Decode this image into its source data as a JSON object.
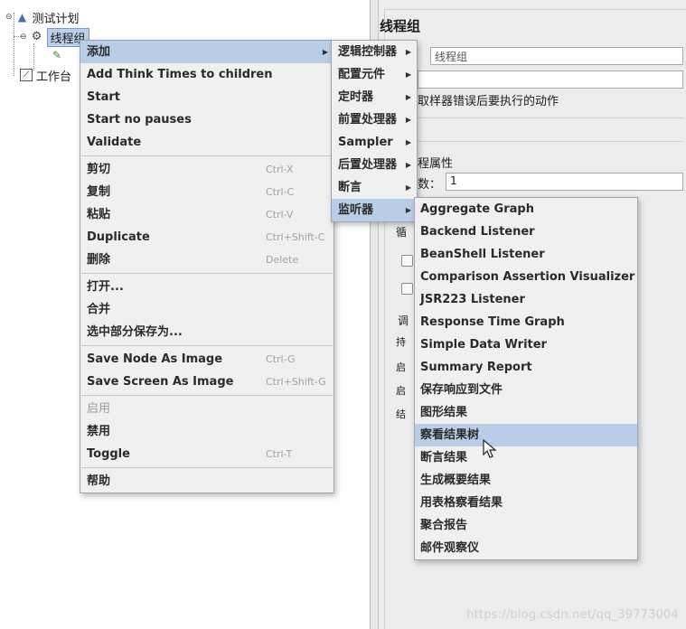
{
  "tree": {
    "plan_label": "测试计划",
    "thread_group_label": "线程组",
    "workbench_label": "工作台"
  },
  "right_pane": {
    "title": "线程组",
    "name_value": "线程组",
    "frag_error_action": "取样器错误后要执行的动作",
    "frag_props": "程属性",
    "frag_threads_prefix": "数：",
    "threads_value": "1",
    "frag_loop": "循",
    "frag_sched": "调",
    "frag_duration": "持",
    "frag_start": "启",
    "frag_start2": "启",
    "frag_end": "结"
  },
  "add_menu": {
    "items": [
      {
        "label": "添加",
        "shortcut": "",
        "submenu": true,
        "selected": true,
        "disabled": false
      },
      {
        "label": "Add Think Times to children",
        "shortcut": "",
        "submenu": false,
        "selected": false,
        "disabled": false
      },
      {
        "label": "Start",
        "shortcut": "",
        "submenu": false,
        "selected": false,
        "disabled": false
      },
      {
        "label": "Start no pauses",
        "shortcut": "",
        "submenu": false,
        "selected": false,
        "disabled": false
      },
      {
        "label": "Validate",
        "shortcut": "",
        "submenu": false,
        "selected": false,
        "disabled": false
      },
      {
        "sep": true
      },
      {
        "label": "剪切",
        "shortcut": "Ctrl-X",
        "submenu": false,
        "selected": false,
        "disabled": false
      },
      {
        "label": "复制",
        "shortcut": "Ctrl-C",
        "submenu": false,
        "selected": false,
        "disabled": false
      },
      {
        "label": "粘贴",
        "shortcut": "Ctrl-V",
        "submenu": false,
        "selected": false,
        "disabled": false
      },
      {
        "label": "Duplicate",
        "shortcut": "Ctrl+Shift-C",
        "submenu": false,
        "selected": false,
        "disabled": false
      },
      {
        "label": "删除",
        "shortcut": "Delete",
        "submenu": false,
        "selected": false,
        "disabled": false
      },
      {
        "sep": true
      },
      {
        "label": "打开...",
        "shortcut": "",
        "submenu": false,
        "selected": false,
        "disabled": false
      },
      {
        "label": "合并",
        "shortcut": "",
        "submenu": false,
        "selected": false,
        "disabled": false
      },
      {
        "label": "选中部分保存为...",
        "shortcut": "",
        "submenu": false,
        "selected": false,
        "disabled": false
      },
      {
        "sep": true
      },
      {
        "label": "Save Node As Image",
        "shortcut": "Ctrl-G",
        "submenu": false,
        "selected": false,
        "disabled": false
      },
      {
        "label": "Save Screen As Image",
        "shortcut": "Ctrl+Shift-G",
        "submenu": false,
        "selected": false,
        "disabled": false
      },
      {
        "sep": true
      },
      {
        "label": "启用",
        "shortcut": "",
        "submenu": false,
        "selected": false,
        "disabled": true
      },
      {
        "label": "禁用",
        "shortcut": "",
        "submenu": false,
        "selected": false,
        "disabled": false
      },
      {
        "label": "Toggle",
        "shortcut": "Ctrl-T",
        "submenu": false,
        "selected": false,
        "disabled": false
      },
      {
        "sep": true
      },
      {
        "label": "帮助",
        "shortcut": "",
        "submenu": false,
        "selected": false,
        "disabled": false
      }
    ]
  },
  "category_menu": {
    "items": [
      {
        "label": "逻辑控制器",
        "submenu": true,
        "selected": false
      },
      {
        "label": "配置元件",
        "submenu": true,
        "selected": false
      },
      {
        "label": "定时器",
        "submenu": true,
        "selected": false
      },
      {
        "label": "前置处理器",
        "submenu": true,
        "selected": false
      },
      {
        "label": "Sampler",
        "submenu": true,
        "selected": false
      },
      {
        "label": "后置处理器",
        "submenu": true,
        "selected": false
      },
      {
        "label": "断言",
        "submenu": true,
        "selected": false
      },
      {
        "label": "监听器",
        "submenu": true,
        "selected": true
      }
    ]
  },
  "listener_menu": {
    "items": [
      {
        "label": "Aggregate Graph",
        "selected": false
      },
      {
        "label": "Backend Listener",
        "selected": false
      },
      {
        "label": "BeanShell Listener",
        "selected": false
      },
      {
        "label": "Comparison Assertion Visualizer",
        "selected": false
      },
      {
        "label": "JSR223 Listener",
        "selected": false
      },
      {
        "label": "Response Time Graph",
        "selected": false
      },
      {
        "label": "Simple Data Writer",
        "selected": false
      },
      {
        "label": "Summary Report",
        "selected": false
      },
      {
        "label": "保存响应到文件",
        "selected": false
      },
      {
        "label": "图形结果",
        "selected": false
      },
      {
        "label": "察看结果树",
        "selected": true
      },
      {
        "label": "断言结果",
        "selected": false
      },
      {
        "label": "生成概要结果",
        "selected": false
      },
      {
        "label": "用表格察看结果",
        "selected": false
      },
      {
        "label": "聚合报告",
        "selected": false
      },
      {
        "label": "邮件观察仪",
        "selected": false
      }
    ]
  },
  "watermark": "https://blog.csdn.net/qq_39773004",
  "colors": {
    "menu_bg": "#f0f0f0",
    "selection": "#b9cde6",
    "shortcut_text": "#a2a2a2"
  }
}
